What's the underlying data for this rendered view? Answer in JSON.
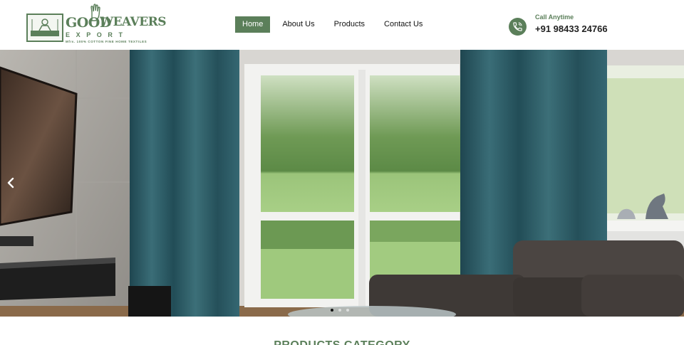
{
  "brand": {
    "name_part1": "GOOD",
    "name_part2": "WEAVERS",
    "sub": "EXPORT",
    "tagline": "Mfrs. 100% COTTON FINE HOME TEXTILES"
  },
  "nav": {
    "items": [
      {
        "label": "Home",
        "active": true
      },
      {
        "label": "About Us",
        "active": false
      },
      {
        "label": "Products",
        "active": false
      },
      {
        "label": "Contact Us",
        "active": false
      }
    ]
  },
  "contact": {
    "label": "Call Anytime",
    "phone": "+91 98433 24766"
  },
  "hero": {
    "prev_icon": "chevron-left-icon",
    "slides_count": 3,
    "active_slide": 1
  },
  "section": {
    "title": "PRODUCTS CATEGORY"
  },
  "colors": {
    "brand_green": "#5b7f5a",
    "curtain_teal": "#2d5a63"
  }
}
